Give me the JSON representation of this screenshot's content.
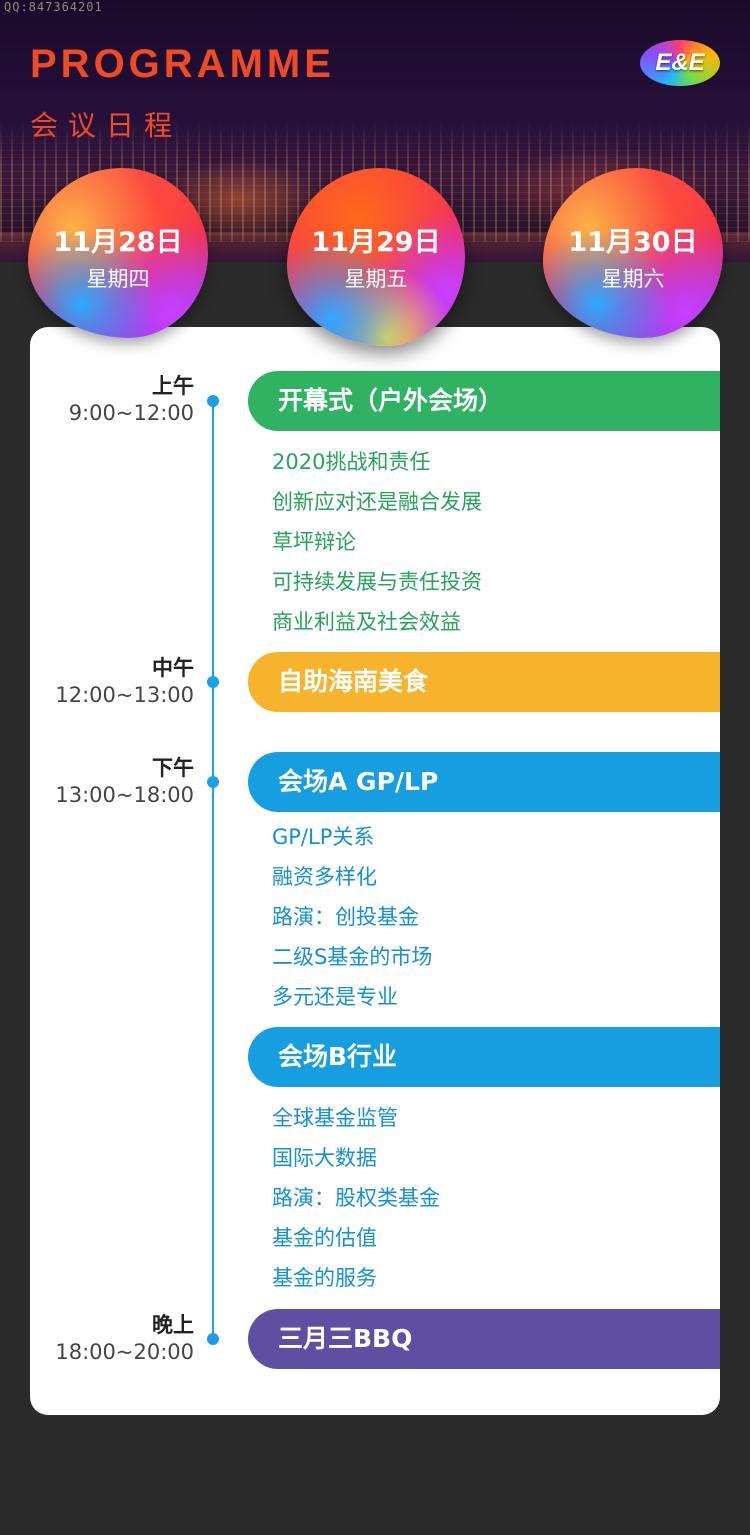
{
  "header": {
    "watermark": "QQ:847364201",
    "title": "PROGRAMME",
    "subtitle": "会议日程",
    "logo_text": "E&E"
  },
  "days": [
    {
      "date": "11月28日",
      "weekday": "星期四"
    },
    {
      "date": "11月29日",
      "weekday": "星期五"
    },
    {
      "date": "11月30日",
      "weekday": "星期六"
    }
  ],
  "periods": [
    {
      "label": "上午",
      "time": "9:00~12:00"
    },
    {
      "label": "中午",
      "time": "12:00~13:00"
    },
    {
      "label": "下午",
      "time": "13:00~18:00"
    },
    {
      "label": "晚上",
      "time": "18:00~20:00"
    }
  ],
  "sessions": [
    {
      "title": "开幕式（户外会场）",
      "color": "#2fb262",
      "items": [
        "2020挑战和责任",
        "创新应对还是融合发展",
        "草坪辩论",
        "可持续发展与责任投资",
        "商业利益及社会效益"
      ],
      "item_color": "#27a35b"
    },
    {
      "title": "自助海南美食",
      "color": "#f7b32b",
      "items": []
    },
    {
      "title": "会场A GP/LP",
      "color": "#169ee0",
      "items": [
        "GP/LP关系",
        "融资多样化",
        "路演：创投基金",
        "二级S基金的市场",
        "多元还是专业"
      ],
      "item_color": "#1590d4"
    },
    {
      "title": "会场B行业",
      "color": "#169ee0",
      "items": [
        "全球基金监管",
        "国际大数据",
        "路演：股权类基金",
        "基金的估值",
        "基金的服务"
      ],
      "item_color": "#1590d4"
    },
    {
      "title": "三月三BBQ",
      "color": "#5e4fa2",
      "items": []
    }
  ]
}
